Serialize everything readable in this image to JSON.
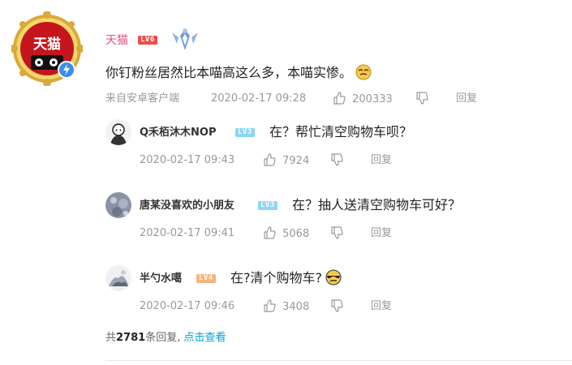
{
  "main_comment": {
    "username": "天猫",
    "level": "LV6",
    "text": "你钉粉丝居然比本喵高这么多，本喵实惨。",
    "source": "来自安卓客户端",
    "time": "2020-02-17 09:28",
    "likes": "200333",
    "reply_label": "回复",
    "avatar_label": "天猫",
    "emoji": "smug-face-emoji"
  },
  "replies": [
    {
      "username": "Q禾栢沐木NOP",
      "level": "LV3",
      "text": "在？帮忙清空购物车呗？",
      "time": "2020-02-17 09:43",
      "likes": "7924",
      "reply_label": "回复"
    },
    {
      "username": "唐某没喜欢的小朋友",
      "level": "LV3",
      "text": "在？抽人送清空购物车可好？",
      "time": "2020-02-17 09:41",
      "likes": "5068",
      "reply_label": "回复"
    },
    {
      "username": "半勺水噶",
      "level": "LV4",
      "text": "在?清个购物车?",
      "time": "2020-02-17 09:46",
      "likes": "3408",
      "reply_label": "回复",
      "emoji": "smug-face-emoji"
    }
  ],
  "footer": {
    "prefix": "共",
    "count": "2781",
    "suffix": "条回复,",
    "link": "点击查看"
  },
  "colors": {
    "username_pink": "#e84e89",
    "link_blue": "#00a1d6",
    "lv6": "#f04c49",
    "lv3": "#8cd6f5",
    "lv4": "#f8b478"
  }
}
